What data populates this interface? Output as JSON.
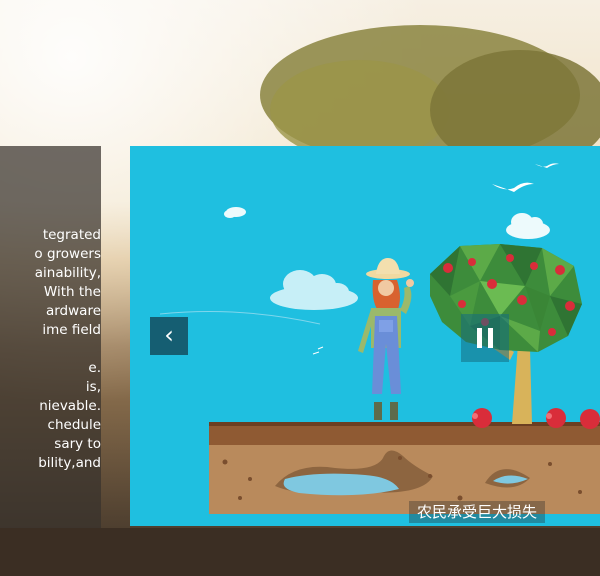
{
  "intro_text": {
    "lines": [
      "tegrated",
      "o growers",
      "ainability,",
      "With the",
      "ardware",
      "ime field",
      "",
      "e.",
      "is,",
      "nievable.",
      "chedule",
      "sary to",
      "bility,and"
    ]
  },
  "video": {
    "subtitle": "农民承受巨大损失",
    "prev_icon": "chevron-left-icon",
    "pause_icon": "pause-icon"
  },
  "colors": {
    "video_bg": "#1fbfe0",
    "control_bg": "#155e72",
    "panel_bg": "#37322c"
  }
}
